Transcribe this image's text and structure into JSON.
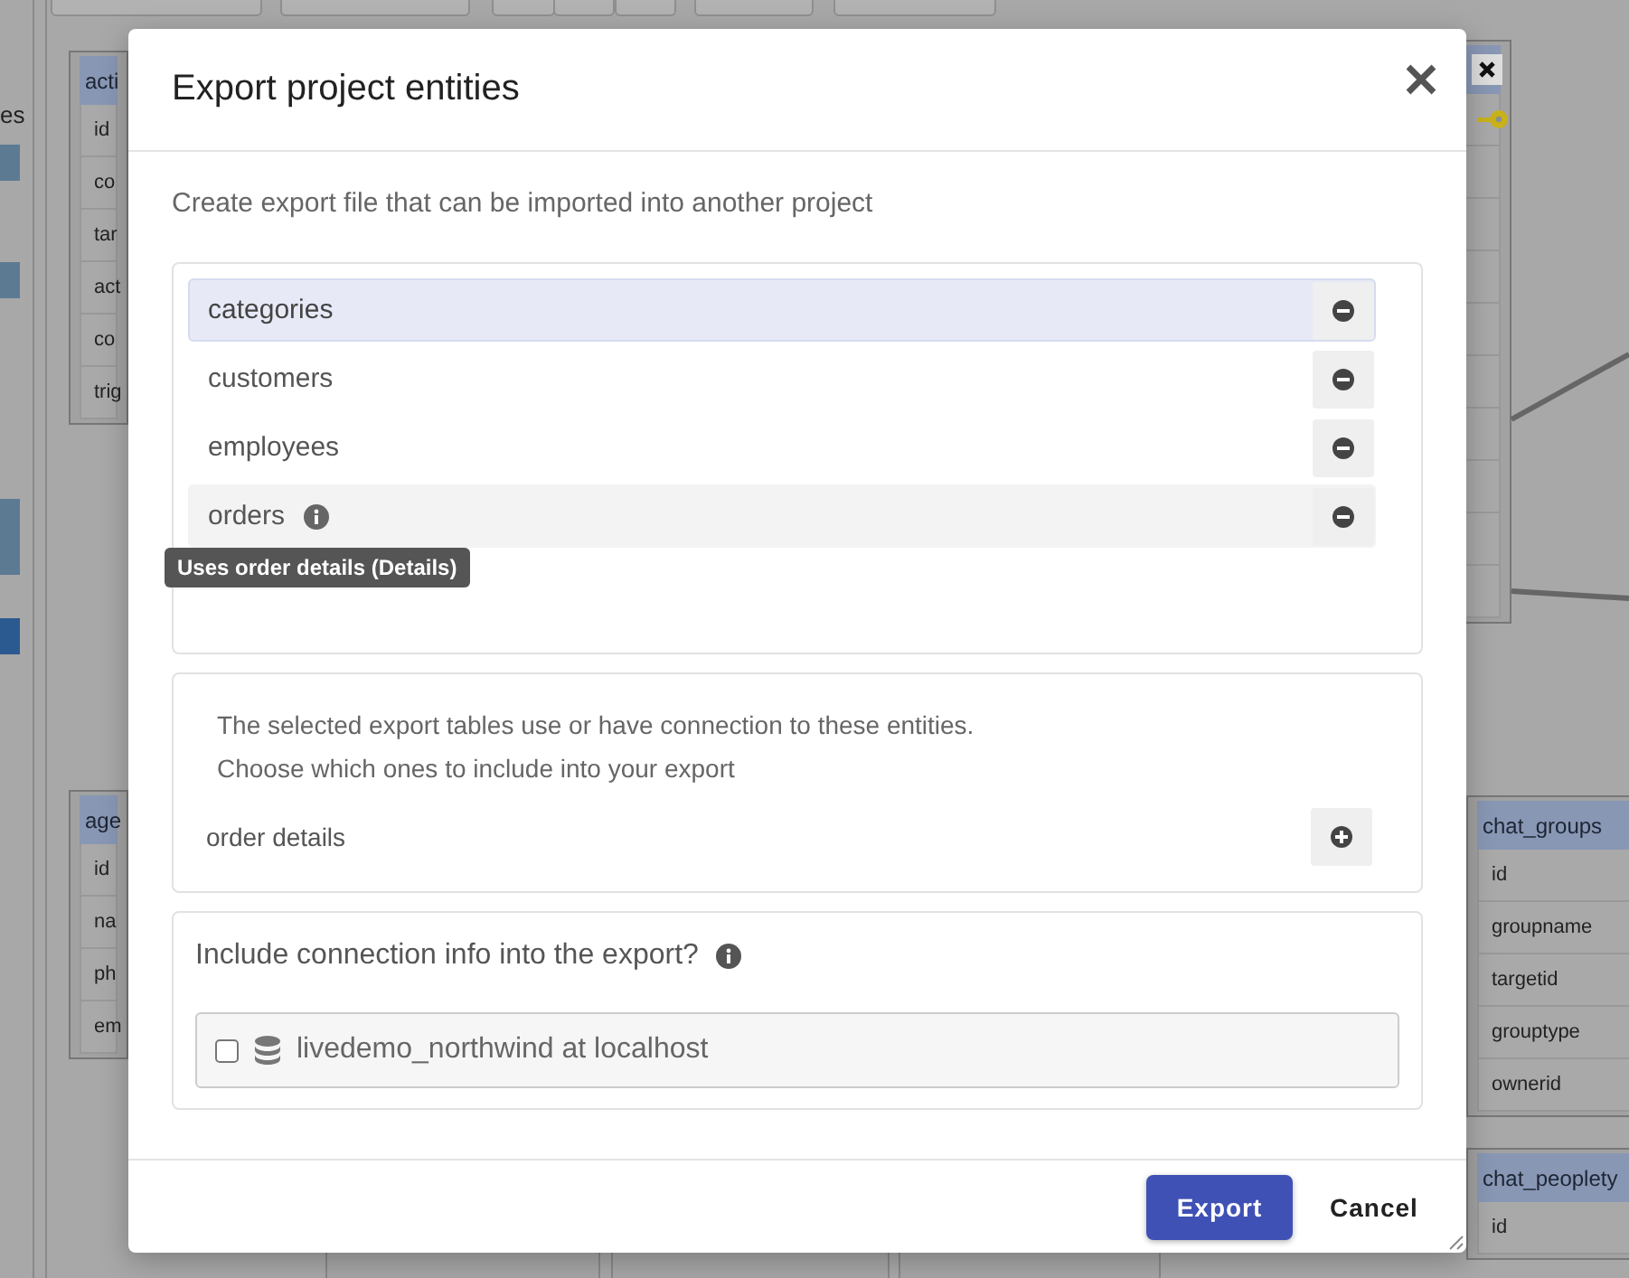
{
  "canvas": {
    "sidebar_label": "es",
    "sidebar_items": [
      {
        "selected": false
      },
      {
        "selected": false
      },
      {
        "selected": false
      },
      {
        "selected": true
      }
    ],
    "tables": [
      {
        "name": "acti",
        "fields": [
          "id",
          "co",
          "tar",
          "act",
          "co",
          "trig"
        ]
      },
      {
        "name": "age",
        "fields": [
          "id",
          "na",
          "ph",
          "em"
        ]
      },
      {
        "name": "chat_groups",
        "fields": [
          "id",
          "groupname",
          "targetid",
          "grouptype",
          "ownerid"
        ]
      },
      {
        "name": "chat_peoplety",
        "fields": [
          "id"
        ]
      }
    ]
  },
  "dialog": {
    "title": "Export project entities",
    "description": "Create export file that can be imported into another project",
    "entities": [
      {
        "name": "categories",
        "selected": true,
        "hovered": false,
        "info": false
      },
      {
        "name": "customers",
        "selected": false,
        "hovered": false,
        "info": false
      },
      {
        "name": "employees",
        "selected": false,
        "hovered": false,
        "info": false
      },
      {
        "name": "orders",
        "selected": false,
        "hovered": true,
        "info": true
      }
    ],
    "tooltip": "Uses order details (Details)",
    "related": {
      "lines": [
        "The selected export tables use or have connection to these entities.",
        "Choose which ones to include into your export"
      ],
      "items": [
        {
          "name": "order details"
        }
      ]
    },
    "connection": {
      "question": "Include connection info into the export?",
      "options": [
        {
          "label": "livedemo_northwind at localhost",
          "checked": false
        }
      ]
    },
    "buttons": [
      {
        "label": "Export",
        "kind": "primary"
      },
      {
        "label": "Cancel",
        "kind": "plain"
      }
    ]
  }
}
